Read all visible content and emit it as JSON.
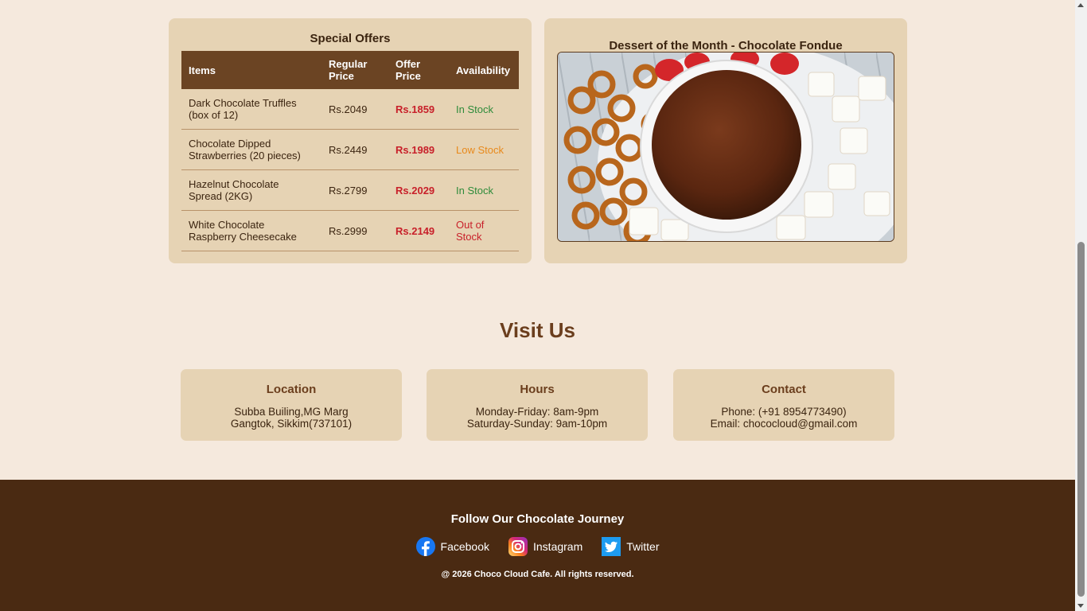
{
  "offers": {
    "title": "Special Offers",
    "headers": [
      "Items",
      "Regular Price",
      "Offer Price",
      "Availability"
    ],
    "rows": [
      {
        "item": "Dark Chocolate Truffles (box of 12)",
        "regular": "Rs.2049",
        "offer": "Rs.1859",
        "availability": "In Stock",
        "status": "instock"
      },
      {
        "item": "Chocolate Dipped Strawberries (20 pieces)",
        "regular": "Rs.2449",
        "offer": "Rs.1989",
        "availability": "Low Stock",
        "status": "lowstock"
      },
      {
        "item": "Hazelnut Chocolate Spread (2KG)",
        "regular": "Rs.2799",
        "offer": "Rs.2029",
        "availability": "In Stock",
        "status": "instock"
      },
      {
        "item": "White Chocolate Raspberry Cheesecake",
        "regular": "Rs.2999",
        "offer": "Rs.2149",
        "availability": "Out of Stock",
        "status": "outstock"
      }
    ]
  },
  "dessert": {
    "title": "Dessert of the Month - Chocolate Fondue"
  },
  "visit": {
    "title": "Visit Us",
    "cards": [
      {
        "title": "Location",
        "lines": [
          "Subba Builing,MG Marg",
          "Gangtok, Sikkim(737101)"
        ]
      },
      {
        "title": "Hours",
        "lines": [
          "Monday-Friday: 8am-9pm",
          "Saturday-Sunday: 9am-10pm"
        ]
      },
      {
        "title": "Contact",
        "lines": [
          "Phone: (+91 8954773490)",
          "Email: chococloud@gmail.com"
        ]
      }
    ]
  },
  "footer": {
    "follow_title": "Follow Our Chocolate Journey",
    "socials": [
      {
        "label": "Facebook",
        "icon": "facebook-icon"
      },
      {
        "label": "Instagram",
        "icon": "instagram-icon"
      },
      {
        "label": "Twitter",
        "icon": "twitter-icon"
      }
    ],
    "copyright": "@ 2026 Choco Cloud Cafe. All rights reserved."
  },
  "colors": {
    "page_bg": "#f5e9dd",
    "panel_bg": "#e6d3b4",
    "table_header": "#6b4423",
    "footer_bg": "#4a2a12",
    "offer_price": "#c8202a",
    "in_stock": "#2e8b3a",
    "low_stock": "#e8891b"
  }
}
